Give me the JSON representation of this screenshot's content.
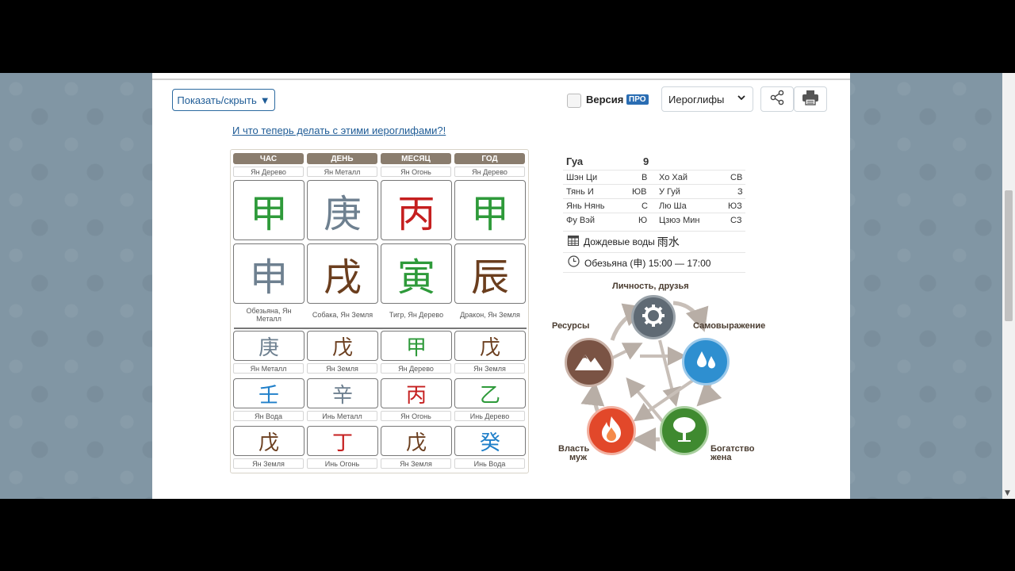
{
  "toolbar": {
    "toggle_label": "Показать/скрыть",
    "pro_label": "Версия",
    "pro_badge": "ПРО",
    "select_value": "Иероглифы",
    "share_icon": "share-icon",
    "print_icon": "printer-icon"
  },
  "link_text": "И что теперь делать с этими иероглифами?!",
  "columns": [
    "ЧАС",
    "ДЕНЬ",
    "МЕСЯЦ",
    "ГОД"
  ],
  "stems": {
    "labels": [
      "Ян Дерево",
      "Ян Металл",
      "Ян Огонь",
      "Ян Дерево"
    ],
    "chars": [
      "甲",
      "庚",
      "丙",
      "甲"
    ],
    "colors": [
      "#2e9a3a",
      "#6e8090",
      "#c51f1f",
      "#2e9a3a"
    ]
  },
  "branches": {
    "chars": [
      "申",
      "戌",
      "寅",
      "辰"
    ],
    "colors": [
      "#6e8090",
      "#6b3e1e",
      "#2e9a3a",
      "#6b3e1e"
    ],
    "labels": [
      "Обезьяна, Ян Металл",
      "Собака, Ян Земля",
      "Тигр, Ян Дерево",
      "Дракон, Ян Земля"
    ]
  },
  "hidden_rows": [
    {
      "chars": [
        "庚",
        "戊",
        "甲",
        "戊"
      ],
      "colors": [
        "#6e8090",
        "#6b3e1e",
        "#2e9a3a",
        "#6b3e1e"
      ],
      "labels": [
        "Ян Металл",
        "Ян Земля",
        "Ян Дерево",
        "Ян Земля"
      ]
    },
    {
      "chars": [
        "壬",
        "辛",
        "丙",
        "乙"
      ],
      "colors": [
        "#1f7fc9",
        "#6e8090",
        "#c51f1f",
        "#2e9a3a"
      ],
      "labels": [
        "Ян Вода",
        "Инь Металл",
        "Ян Огонь",
        "Инь Дерево"
      ]
    },
    {
      "chars": [
        "戊",
        "丁",
        "戊",
        "癸"
      ],
      "colors": [
        "#6b3e1e",
        "#c51f1f",
        "#6b3e1e",
        "#1f7fc9"
      ],
      "labels": [
        "Ян Земля",
        "Инь Огонь",
        "Ян Земля",
        "Инь Вода"
      ]
    }
  ],
  "gua": {
    "title": "Гуа",
    "number": "9",
    "rows": [
      {
        "a": "Шэн Ци",
        "av": "В",
        "b": "Хо Хай",
        "bv": "СВ"
      },
      {
        "a": "Тянь И",
        "av": "ЮВ",
        "b": "У Гуй",
        "bv": "З"
      },
      {
        "a": "Янь Нянь",
        "av": "С",
        "b": "Лю Ша",
        "bv": "ЮЗ"
      },
      {
        "a": "Фу Вэй",
        "av": "Ю",
        "b": "Цзюэ Мин",
        "bv": "СЗ"
      }
    ]
  },
  "solar_term": {
    "text": "Дождевые воды",
    "chars": "雨水",
    "icon": "calendar-icon"
  },
  "hour": {
    "text": "Обезьяна (申) 15:00 — 17:00",
    "icon": "clock-icon"
  },
  "elements": {
    "top": "Личность, друзья",
    "right": "Самовыражение",
    "left": "Ресурсы",
    "bottom_left_1": "Власть",
    "bottom_left_2": "муж",
    "bottom_right_1": "Богатство",
    "bottom_right_2": "жена",
    "colors": {
      "metal": "#5f6a74",
      "water": "#2e8fd0",
      "wood": "#3f8a30",
      "fire": "#e2482a",
      "earth": "#7a5344"
    }
  }
}
